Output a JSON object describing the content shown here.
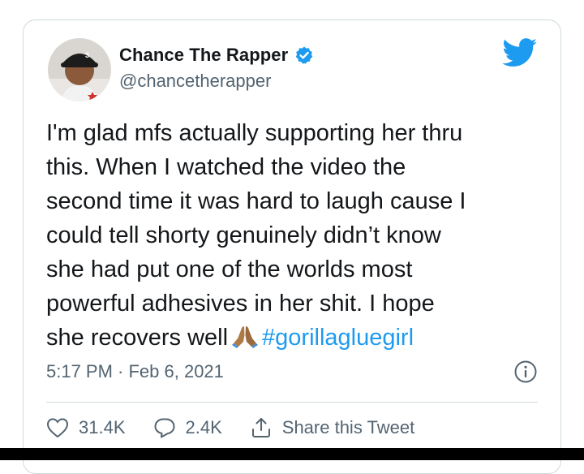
{
  "tweet": {
    "display_name": "Chance The Rapper",
    "handle": "@chancetherapper",
    "text_lines": [
      "I'm glad mfs actually supporting her thru",
      "this. When I watched the video the",
      "second time it was hard to laugh cause I",
      "could tell shorty genuinely didn’t know",
      "she had put one of the worlds most",
      "powerful adhesives in her shit. I hope"
    ],
    "last_line_text": "she recovers well",
    "emoji": "folded-hands-emoji",
    "hashtag": "#gorillagluegirl",
    "timestamp": "5:17 PM · Feb 6, 2021",
    "likes": "31.4K",
    "replies": "2.4K",
    "share_label": "Share this Tweet"
  },
  "icons": {
    "verified": "verified-badge-icon",
    "brand": "twitter-bird-icon",
    "info": "info-icon",
    "like": "heart-icon",
    "reply": "reply-bubble-icon",
    "share": "share-upload-icon"
  },
  "colors": {
    "accent": "#1d9bf0",
    "text": "#14171a",
    "secondary_text": "#536471",
    "border": "#cfd9de"
  }
}
